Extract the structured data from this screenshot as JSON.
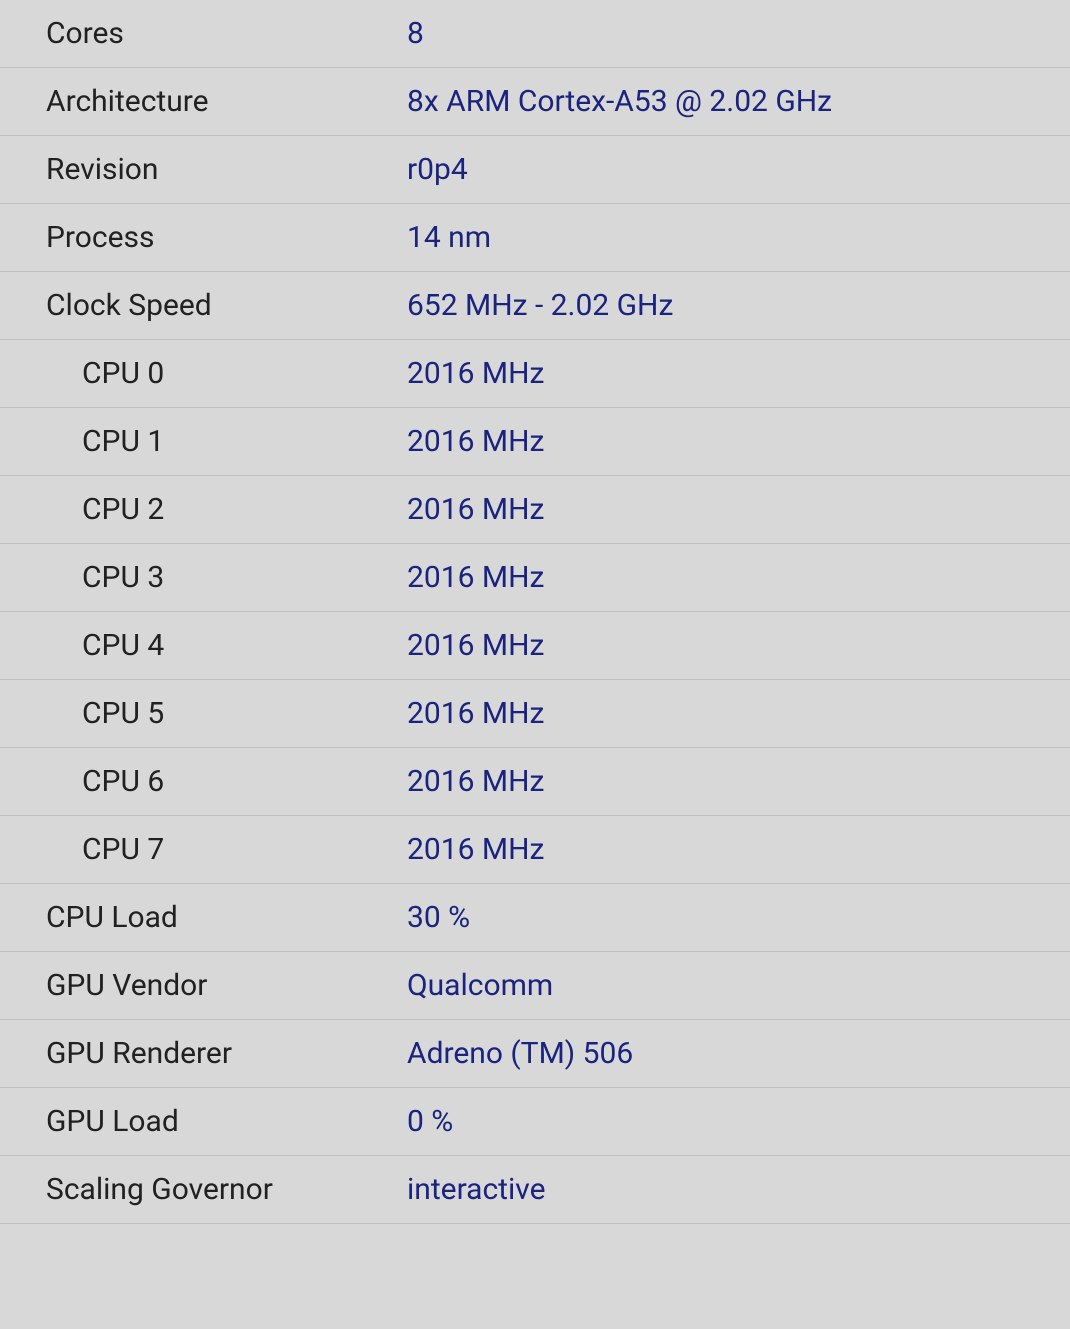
{
  "rows": [
    {
      "label": "Cores",
      "value": "8",
      "indented": false
    },
    {
      "label": "Architecture",
      "value": "8x ARM Cortex-A53 @ 2.02 GHz",
      "indented": false
    },
    {
      "label": "Revision",
      "value": "r0p4",
      "indented": false
    },
    {
      "label": "Process",
      "value": "14 nm",
      "indented": false
    },
    {
      "label": "Clock Speed",
      "value": "652 MHz - 2.02 GHz",
      "indented": false
    },
    {
      "label": "CPU 0",
      "value": "2016 MHz",
      "indented": true
    },
    {
      "label": "CPU 1",
      "value": "2016 MHz",
      "indented": true
    },
    {
      "label": "CPU 2",
      "value": "2016 MHz",
      "indented": true
    },
    {
      "label": "CPU 3",
      "value": "2016 MHz",
      "indented": true
    },
    {
      "label": "CPU 4",
      "value": "2016 MHz",
      "indented": true
    },
    {
      "label": "CPU 5",
      "value": "2016 MHz",
      "indented": true
    },
    {
      "label": "CPU 6",
      "value": "2016 MHz",
      "indented": true
    },
    {
      "label": "CPU 7",
      "value": "2016 MHz",
      "indented": true
    },
    {
      "label": "CPU Load",
      "value": "30 %",
      "indented": false
    },
    {
      "label": "GPU Vendor",
      "value": "Qualcomm",
      "indented": false
    },
    {
      "label": "GPU Renderer",
      "value": "Adreno (TM) 506",
      "indented": false
    },
    {
      "label": "GPU Load",
      "value": "0 %",
      "indented": false
    },
    {
      "label": "Scaling Governor",
      "value": "interactive",
      "indented": false
    }
  ]
}
